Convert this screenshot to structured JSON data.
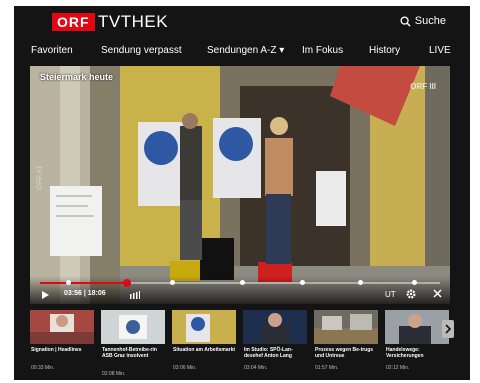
{
  "header": {
    "logo": "ORF",
    "brand": "TVTHEK",
    "search_label": "Suche",
    "search_icon": "search-icon"
  },
  "nav": [
    {
      "label": "Favoriten"
    },
    {
      "label": "Sendung verpasst"
    },
    {
      "label": "Sendungen A-Z ▾"
    },
    {
      "label": "Im Fokus"
    },
    {
      "label": "History"
    },
    {
      "label": "LIVE"
    }
  ],
  "player": {
    "title": "Steiermark heute",
    "watermark": "ORF III",
    "side_label": "ORF.AT",
    "elapsed": "03:56",
    "duration": "18:06",
    "progress": 0.2175,
    "subtitles_label": "UT",
    "accent_color": "#e30613"
  },
  "strip": [
    {
      "title": "Signation | Headlines",
      "duration": "00:33 Min."
    },
    {
      "title": "Tannenhof-Betreibe-rin ASB Graz insolvent",
      "duration": "02:08 Min."
    },
    {
      "title": "Situation am Arbeitsmarkt",
      "duration": "03:06 Min."
    },
    {
      "title": "Im Studio: SPÖ-Lan-desehef Anton Lang",
      "duration": "03:04 Min."
    },
    {
      "title": "Prozess wegen Be-trugs und Untreue",
      "duration": "01:57 Min."
    },
    {
      "title": "Handelswege: Versicherungen",
      "duration": "02:12 Min."
    }
  ]
}
